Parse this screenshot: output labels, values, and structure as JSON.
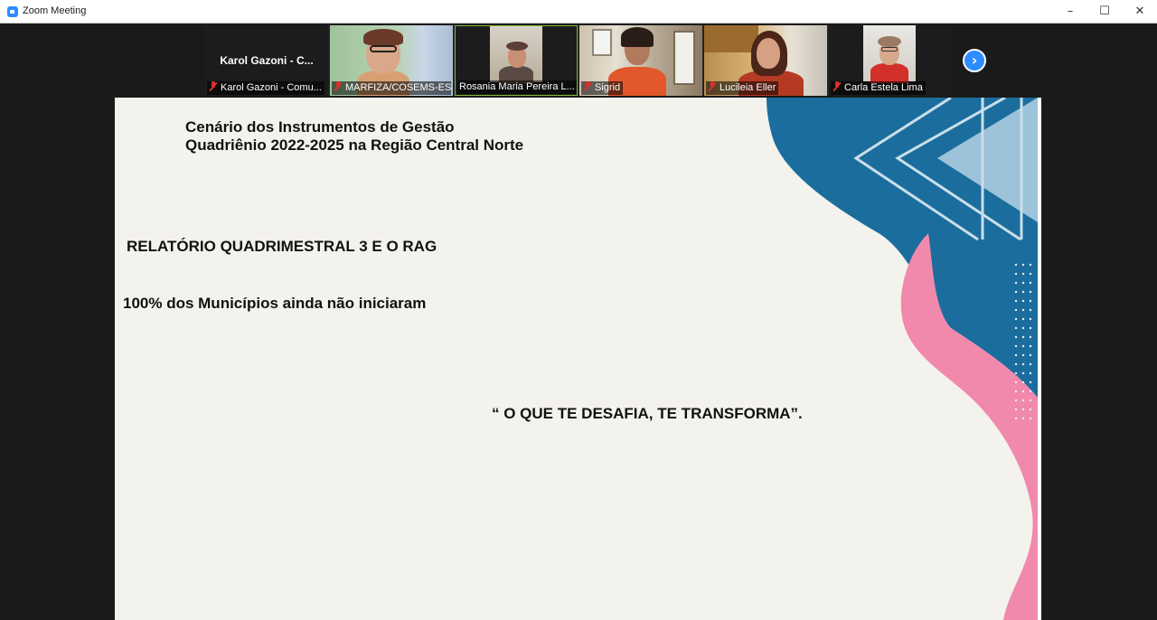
{
  "window": {
    "title": "Zoom Meeting",
    "controls": {
      "minimize": "–",
      "maximize": "☐",
      "close": "✕"
    }
  },
  "participants": [
    {
      "label": "Karol Gazoni - Comu...",
      "center_name": "Karol Gazoni - C...",
      "video": false,
      "muted": true
    },
    {
      "label": "MARFIZA/COSEMS-ES",
      "video": true,
      "muted": true
    },
    {
      "label": "Rosania Maria Pereira L...",
      "video": true,
      "muted": false,
      "active_speaker": true
    },
    {
      "label": "Sigrid",
      "video": true,
      "muted": true
    },
    {
      "label": "Lucileia Eller",
      "video": true,
      "muted": true
    },
    {
      "label": "Carla Estela Lima",
      "video": true,
      "muted": true
    }
  ],
  "next_page_icon": "chevron-right-icon",
  "slide": {
    "title_line1": "Cenário dos Instrumentos de Gestão",
    "title_line2": "Quadriênio 2022-2025 na Região Central Norte",
    "report_line": "RELATÓRIO QUADRIMESTRAL 3  E O RAG",
    "status_line": "100% dos  Municípios ainda não iniciaram",
    "quote": "“ O QUE TE DESAFIA, TE TRANSFORMA”.",
    "colors": {
      "background": "#f4f2ec",
      "blue": "#1b6d9e",
      "light_blue": "#9cc3d9",
      "pink": "#f189ac",
      "text": "#111111"
    }
  },
  "colors": {
    "zoom_blue": "#2d8cff",
    "active_border": "#7fb93a",
    "mute_red": "#d9302c",
    "dark_bg": "#1a1a1a"
  }
}
